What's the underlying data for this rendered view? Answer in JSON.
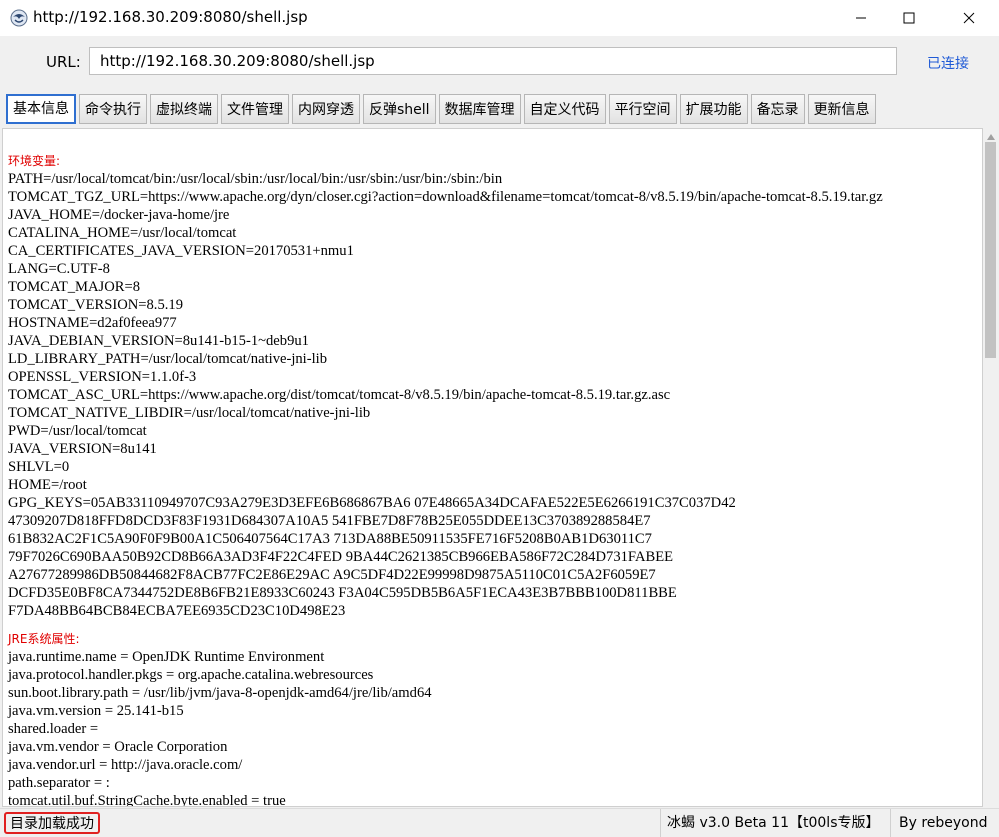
{
  "window": {
    "title": "http://192.168.30.209:8080/shell.jsp"
  },
  "urlbar": {
    "label": "URL:",
    "value": "http://192.168.30.209:8080/shell.jsp",
    "status": "已连接"
  },
  "tabs": [
    {
      "label": "基本信息",
      "active": true
    },
    {
      "label": "命令执行"
    },
    {
      "label": "虚拟终端"
    },
    {
      "label": "文件管理"
    },
    {
      "label": "内网穿透"
    },
    {
      "label": "反弹shell"
    },
    {
      "label": "数据库管理"
    },
    {
      "label": "自定义代码"
    },
    {
      "label": "平行空间"
    },
    {
      "label": "扩展功能"
    },
    {
      "label": "备忘录"
    },
    {
      "label": "更新信息"
    }
  ],
  "env": {
    "title": "环境变量:",
    "lines": [
      "PATH=/usr/local/tomcat/bin:/usr/local/sbin:/usr/local/bin:/usr/sbin:/usr/bin:/sbin:/bin",
      "TOMCAT_TGZ_URL=https://www.apache.org/dyn/closer.cgi?action=download&filename=tomcat/tomcat-8/v8.5.19/bin/apache-tomcat-8.5.19.tar.gz",
      "JAVA_HOME=/docker-java-home/jre",
      "CATALINA_HOME=/usr/local/tomcat",
      "CA_CERTIFICATES_JAVA_VERSION=20170531+nmu1",
      "LANG=C.UTF-8",
      "TOMCAT_MAJOR=8",
      "TOMCAT_VERSION=8.5.19",
      "HOSTNAME=d2af0feea977",
      "JAVA_DEBIAN_VERSION=8u141-b15-1~deb9u1",
      "LD_LIBRARY_PATH=/usr/local/tomcat/native-jni-lib",
      "OPENSSL_VERSION=1.1.0f-3",
      "TOMCAT_ASC_URL=https://www.apache.org/dist/tomcat/tomcat-8/v8.5.19/bin/apache-tomcat-8.5.19.tar.gz.asc",
      "TOMCAT_NATIVE_LIBDIR=/usr/local/tomcat/native-jni-lib",
      "PWD=/usr/local/tomcat",
      "JAVA_VERSION=8u141",
      "SHLVL=0",
      "HOME=/root",
      "GPG_KEYS=05AB33110949707C93A279E3D3EFE6B686867BA6 07E48665A34DCAFAE522E5E6266191C37C037D42",
      "47309207D818FFD8DCD3F83F1931D684307A10A5 541FBE7D8F78B25E055DDEE13C370389288584E7",
      "61B832AC2F1C5A90F0F9B00A1C506407564C17A3 713DA88BE50911535FE716F5208B0AB1D63011C7",
      "79F7026C690BAA50B92CD8B66A3AD3F4F22C4FED 9BA44C2621385CB966EBA586F72C284D731FABEE",
      "A27677289986DB50844682F8ACB77FC2E86E29AC A9C5DF4D22E99998D9875A5110C01C5A2F6059E7",
      "DCFD35E0BF8CA7344752DE8B6FB21E8933C60243 F3A04C595DB5B6A5F1ECA43E3B7BBB100D811BBE",
      "F7DA48BB64BCB84ECBA7EE6935CD23C10D498E23"
    ]
  },
  "jre": {
    "title": "JRE系统属性:",
    "lines": [
      "java.runtime.name = OpenJDK Runtime Environment",
      "java.protocol.handler.pkgs = org.apache.catalina.webresources",
      "sun.boot.library.path = /usr/lib/jvm/java-8-openjdk-amd64/jre/lib/amd64",
      "java.vm.version = 25.141-b15",
      "shared.loader =",
      "java.vm.vendor = Oracle Corporation",
      "java.vendor.url = http://java.oracle.com/",
      "path.separator = :",
      "tomcat.util.buf.StringCache.byte.enabled = true"
    ]
  },
  "statusbar": {
    "message": "目录加载成功",
    "version": "冰蝎 v3.0 Beta 11【t00ls专版】",
    "author": "By rebeyond"
  }
}
